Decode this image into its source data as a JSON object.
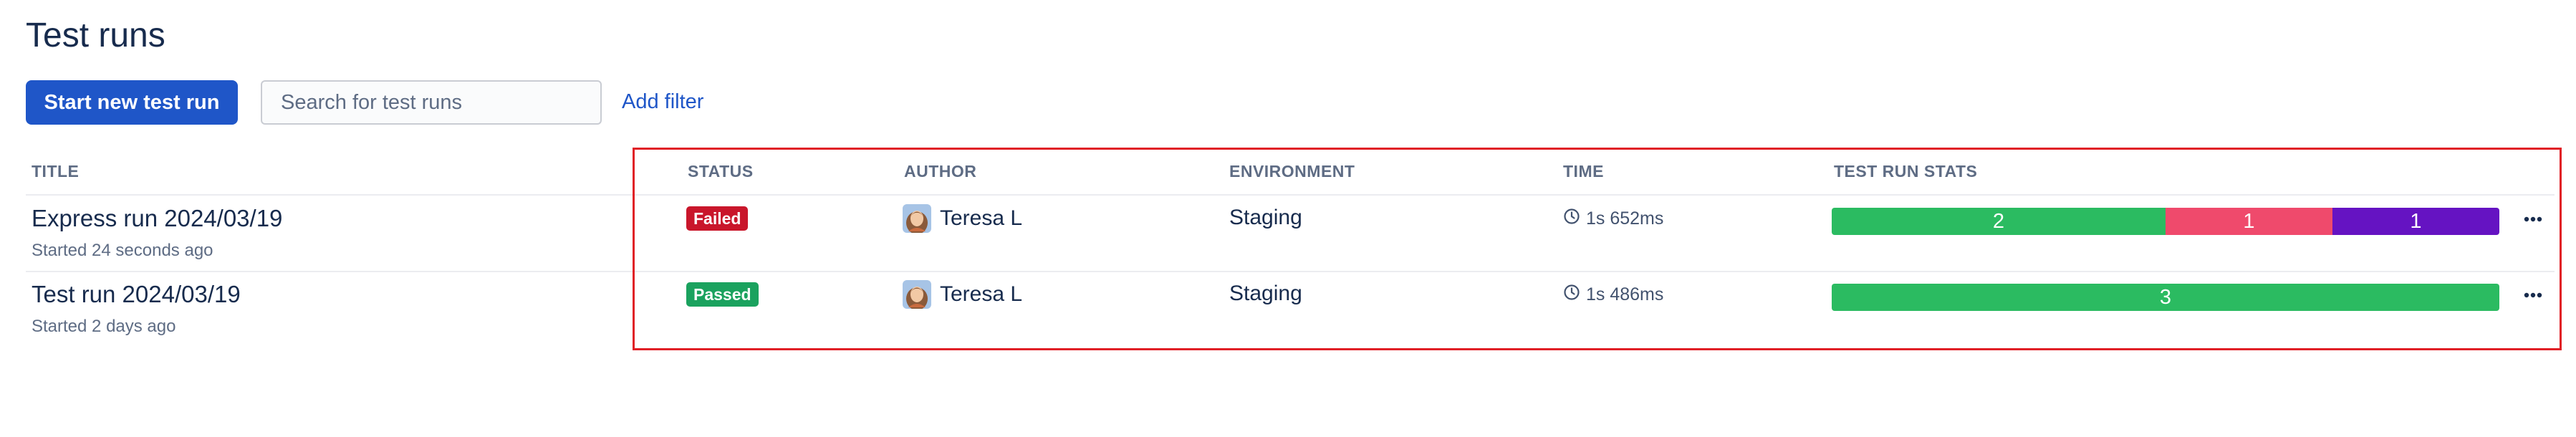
{
  "page": {
    "title": "Test runs"
  },
  "toolbar": {
    "start_label": "Start new test run",
    "search_placeholder": "Search for test runs",
    "search_value": "",
    "filter_label": "Add filter"
  },
  "table": {
    "columns": [
      "TITLE",
      "STATUS",
      "AUTHOR",
      "ENVIRONMENT",
      "TIME",
      "TEST RUN STATS"
    ],
    "rows": [
      {
        "title": "Express run 2024/03/19",
        "subtitle": "Started 24 seconds ago",
        "status": "Failed",
        "author": "Teresa L",
        "environment": "Staging",
        "time": "1s 652ms",
        "stats": [
          {
            "value": "2",
            "color": "#2bbb61",
            "fraction": 0.5
          },
          {
            "value": "1",
            "color": "#ef4a6c",
            "fraction": 0.25
          },
          {
            "value": "1",
            "color": "#6513c2",
            "fraction": 0.25
          }
        ]
      },
      {
        "title": "Test run 2024/03/19",
        "subtitle": "Started 2 days ago",
        "status": "Passed",
        "author": "Teresa L",
        "environment": "Staging",
        "time": "1s 486ms",
        "stats": [
          {
            "value": "3",
            "color": "#2bbb61",
            "fraction": 1.0
          }
        ]
      }
    ]
  },
  "colors": {
    "primary": "#1f56c8",
    "failed": "#c9162b",
    "passed": "#1aa25e",
    "highlight": "#e01f26"
  },
  "icons": {
    "clock": "clock-icon",
    "more": "more-horizontal-icon",
    "avatar": "avatar"
  }
}
